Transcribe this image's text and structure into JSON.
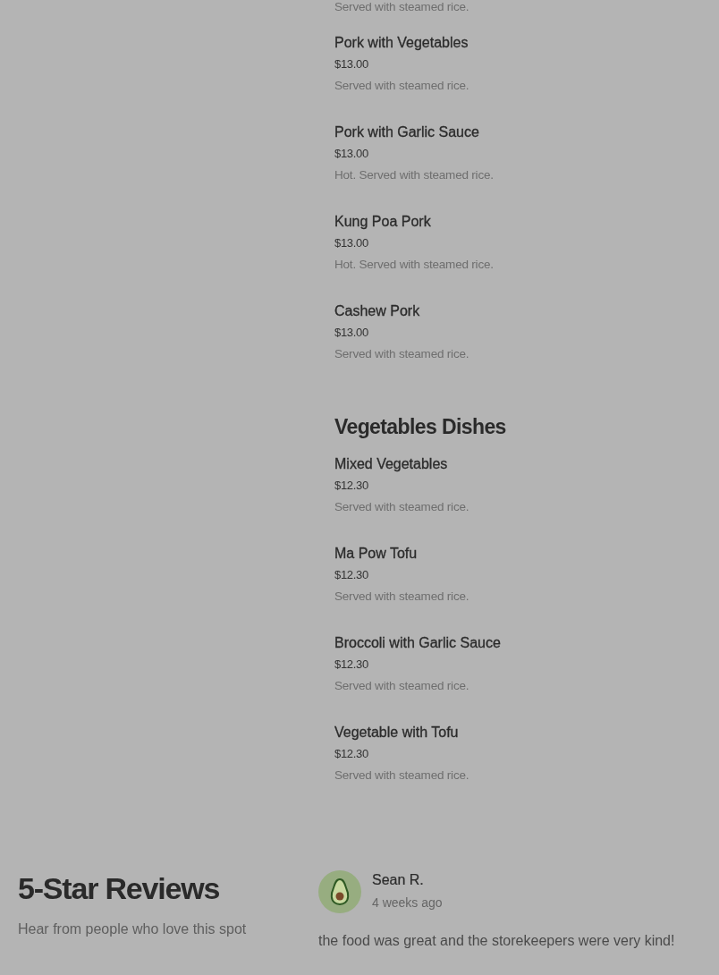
{
  "menu_sections": [
    {
      "items": [
        {
          "description": "Served with steamed rice."
        },
        {
          "name": "Pork with Vegetables",
          "price": "$13.00",
          "description": "Served with steamed rice."
        },
        {
          "name": "Pork with Garlic Sauce",
          "price": "$13.00",
          "description": "Hot. Served with steamed rice."
        },
        {
          "name": "Kung Poa Pork",
          "price": "$13.00",
          "description": "Hot. Served with steamed rice."
        },
        {
          "name": "Cashew Pork",
          "price": "$13.00",
          "description": "Served with steamed rice."
        }
      ]
    },
    {
      "title": "Vegetables Dishes",
      "items": [
        {
          "name": "Mixed Vegetables",
          "price": "$12.30",
          "description": "Served with steamed rice."
        },
        {
          "name": "Ma Pow Tofu",
          "price": "$12.30",
          "description": "Served with steamed rice."
        },
        {
          "name": "Broccoli with Garlic Sauce",
          "price": "$12.30",
          "description": "Served with steamed rice."
        },
        {
          "name": "Vegetable with Tofu",
          "price": "$12.30",
          "description": "Served with steamed rice."
        }
      ]
    }
  ],
  "reviews": {
    "title": "5-Star Reviews",
    "subtitle": "Hear from people who love this spot",
    "items": [
      {
        "author": "Sean R.",
        "time": "4 weeks ago",
        "text": "the food was great and the storekeepers were very kind!"
      }
    ]
  }
}
